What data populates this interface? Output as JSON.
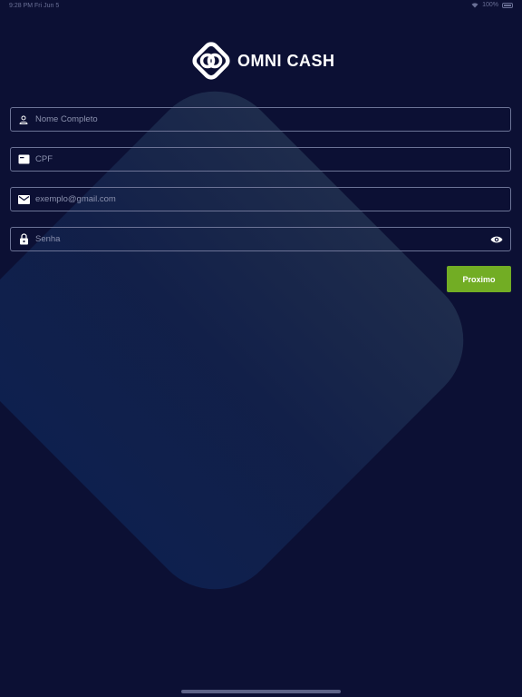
{
  "status_bar": {
    "time_date": "9:28 PM  Fri Jun 5",
    "battery": "100%",
    "battery_level": 1.0,
    "icons": [
      "wifi-icon",
      "battery-icon"
    ]
  },
  "logo": {
    "text": "OMNI CASH"
  },
  "form": {
    "full_name": {
      "value": "",
      "placeholder": "Nome Completo",
      "icon": "person-icon"
    },
    "cpf": {
      "value": "",
      "placeholder": "CPF",
      "icon": "id-card-icon"
    },
    "email": {
      "value": "",
      "placeholder": "exemplo@gmail.com",
      "icon": "mail-icon"
    },
    "password": {
      "value": "",
      "placeholder": "Senha",
      "icon": "lock-icon",
      "toggle_icon": "eye-icon"
    }
  },
  "buttons": {
    "next_label": "Proximo"
  },
  "colors": {
    "background": "#0c1034",
    "accent": "#72ad24",
    "field_border": "#6c7396",
    "placeholder": "#8b91ae"
  }
}
